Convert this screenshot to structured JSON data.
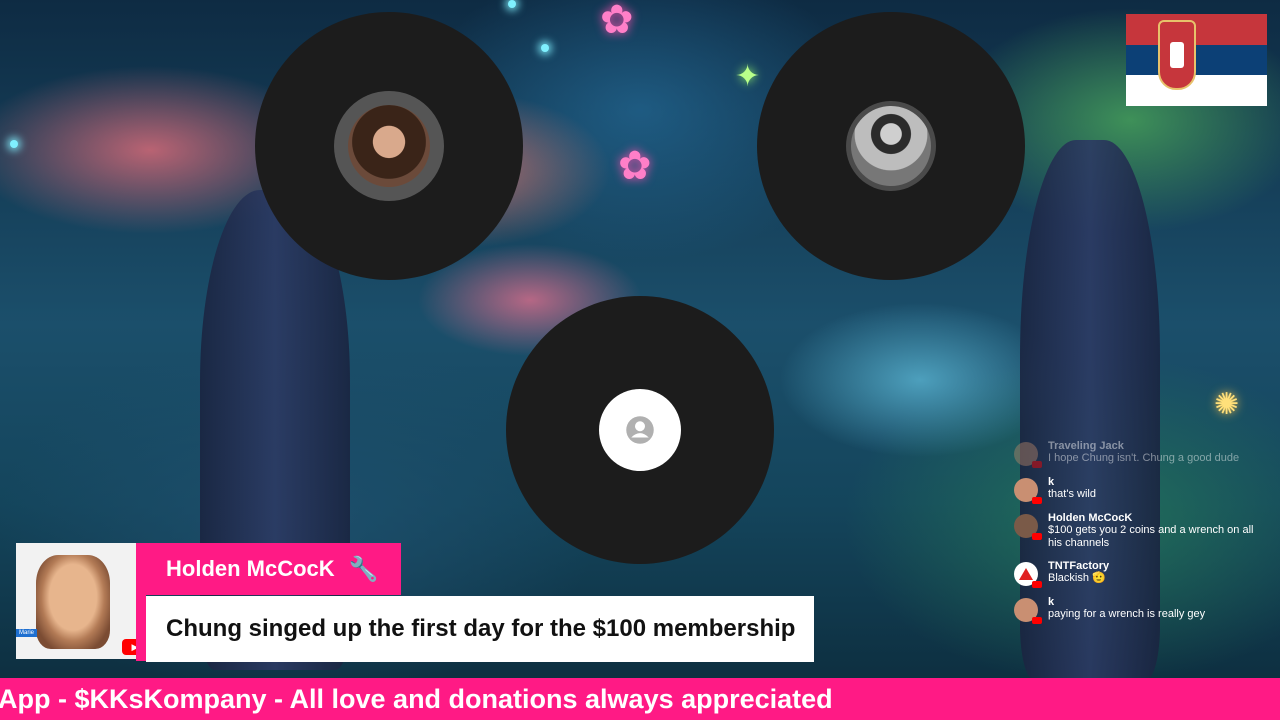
{
  "stage": {
    "participants": [
      {
        "name": "participant-woman",
        "avatar": "photo"
      },
      {
        "name": "participant-man",
        "avatar": "photo"
      },
      {
        "name": "participant-empty",
        "avatar": "default-person-icon"
      }
    ]
  },
  "flag": {
    "country_icon": "serbia-flag-icon",
    "colors": [
      "#c6363c",
      "#0c4076",
      "#ffffff"
    ]
  },
  "chat": {
    "messages": [
      {
        "author": "Traveling Jack",
        "text": "I hope Chung isn't. Chung a good dude"
      },
      {
        "author": "k",
        "text": "that's wild"
      },
      {
        "author": "Holden McCocK",
        "text": "$100 gets you 2 coins and a wrench on all his channels"
      },
      {
        "author": "TNTFactory",
        "text": "Blackish 🫡"
      },
      {
        "author": "k",
        "text": "paying for a wrench is really gey"
      }
    ]
  },
  "highlight": {
    "cam_label": "Marie",
    "author": "Holden McCocK",
    "badge_icon": "wrench-icon",
    "badge_glyph": "🔧",
    "comment": "Chung singed up the first day for the $100 membership",
    "accent": "#ff1a85"
  },
  "ticker": {
    "text": "App - $KKsKompany - All love and donations always appreciated"
  }
}
